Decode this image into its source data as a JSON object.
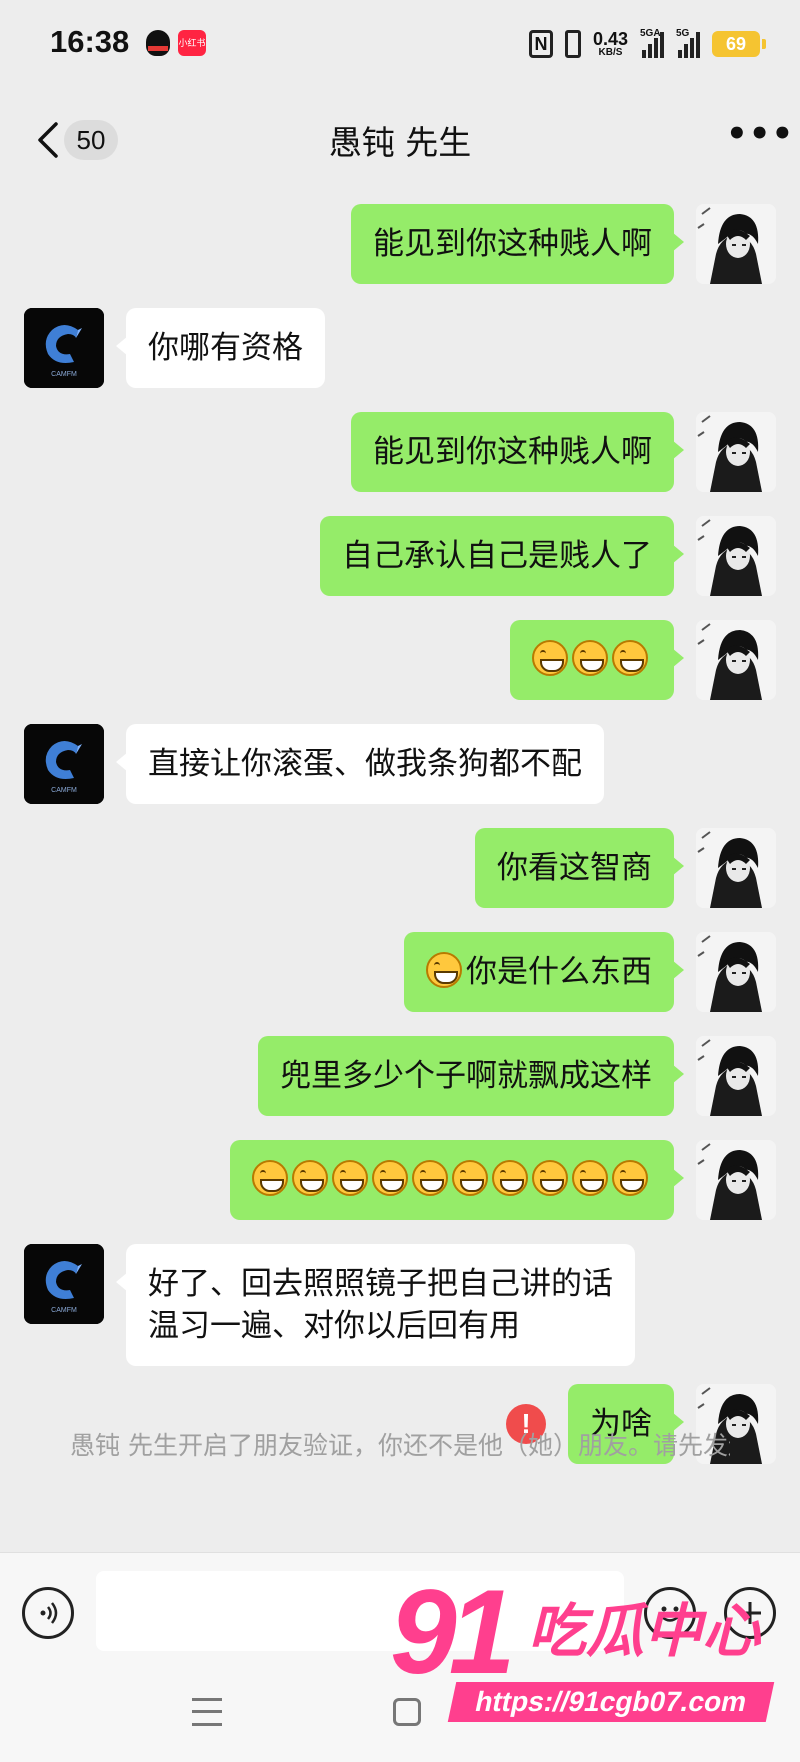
{
  "status_bar": {
    "time": "16:38",
    "xhs_label": "小红书",
    "nfc": "N",
    "net_speed": "0.43",
    "net_unit": "KB/S",
    "signal1": "5GA",
    "signal2": "5G",
    "battery": "69"
  },
  "header": {
    "unread_count": "50",
    "title": "愚钝 先生"
  },
  "messages": [
    {
      "from": "me",
      "text": "能见到你这种贱人啊"
    },
    {
      "from": "them",
      "text": "你哪有资格"
    },
    {
      "from": "me",
      "text": "能见到你这种贱人啊"
    },
    {
      "from": "me",
      "text": "自己承认自己是贱人了"
    },
    {
      "from": "me",
      "text": "",
      "emoji_count": 3
    },
    {
      "from": "them",
      "text": "直接让你滚蛋、做我条狗都不配"
    },
    {
      "from": "me",
      "text": "你看这智商"
    },
    {
      "from": "me",
      "text": "你是什么东西",
      "emoji_count": 1
    },
    {
      "from": "me",
      "text": "兜里多少个子啊就飘成这样"
    },
    {
      "from": "me",
      "text": "",
      "emoji_count": 10
    },
    {
      "from": "them",
      "text": "好了、回去照照镜子把自己讲的话\n温习一遍、对你以后回有用"
    },
    {
      "from": "me",
      "text": "为啥",
      "failed": true
    }
  ],
  "alert_glyph": "!",
  "system_notice": "愚钝 先生开启了朋友验证，你还不是他（她）朋友。请先发送朋友验证请求，对方验证通过后，才能聊天。",
  "watermark": {
    "number": "91",
    "text": "吃瓜中心",
    "url": "https://91cgb07.com"
  },
  "icons": {
    "back": "chevron-left-icon",
    "more": "more-icon",
    "voice": "voice-icon",
    "emoji": "emoji-icon",
    "add": "plus-icon",
    "emoji_grin": "grinning-face-icon"
  },
  "colors": {
    "my_bubble": "#95ec69",
    "their_bubble": "#ffffff",
    "background": "#ededed",
    "alert": "#f04c4c",
    "watermark": "#ff3f8e"
  }
}
